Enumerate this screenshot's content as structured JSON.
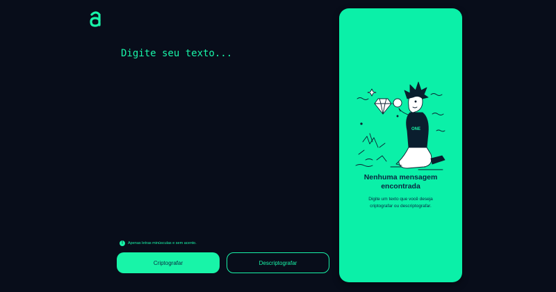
{
  "logo": {
    "icon": "alura-a-logo",
    "color": "#18f4a8"
  },
  "input": {
    "placeholder": "Digite seu texto..."
  },
  "hint": {
    "icon": "info-icon",
    "text": "Apenas letras minúsculas e sem acento."
  },
  "actions": {
    "encrypt_label": "Criptografar",
    "decrypt_label": "Descriptografar"
  },
  "output_panel": {
    "illustration": "person-with-magnifying-glass-and-diamond",
    "badge_text": "ONE",
    "title_line1": "Nenhuma mensagem",
    "title_line2": "encontrada",
    "desc_line1": "Digite um texto que você deseja",
    "desc_line2": "criptografar ou descriptografar."
  },
  "colors": {
    "background": "#080d1a",
    "accent": "#18f4a8",
    "panel": "#0bf0a8",
    "panel_text": "#0a2540"
  }
}
